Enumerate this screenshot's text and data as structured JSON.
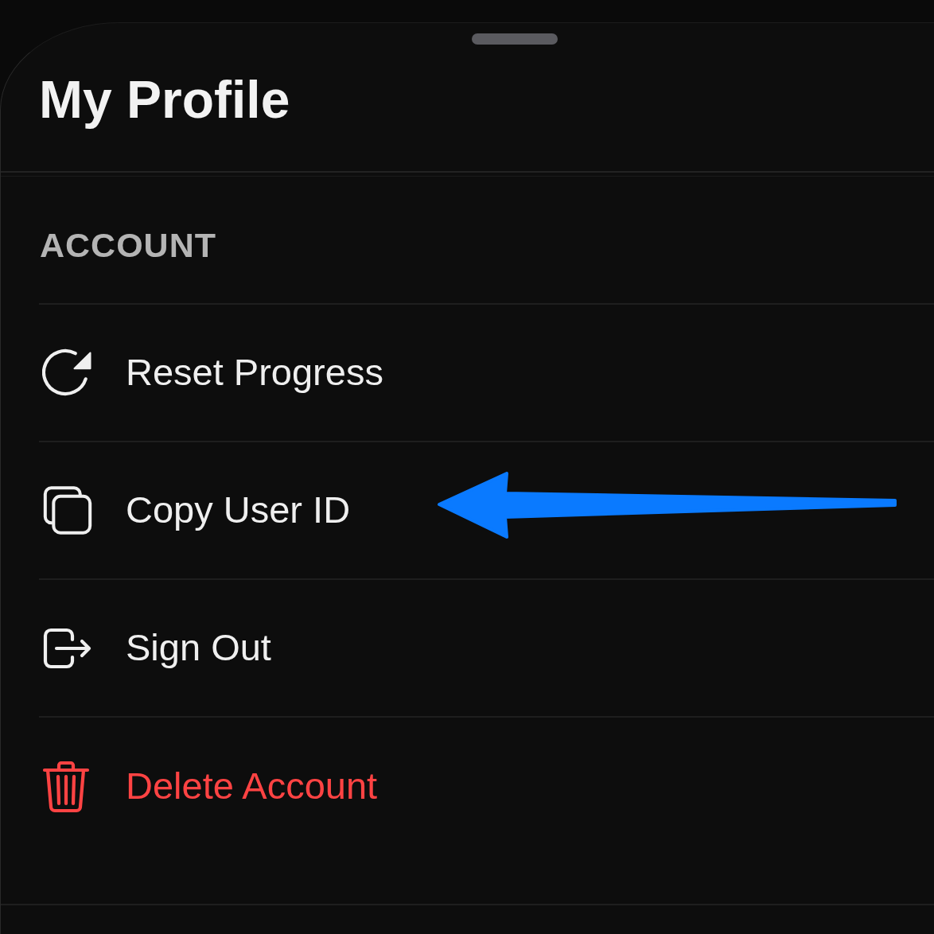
{
  "sheet": {
    "title": "My Profile"
  },
  "section": {
    "header": "ACCOUNT",
    "items": [
      {
        "label": "Reset Progress",
        "kind": "default",
        "annotated": false
      },
      {
        "label": "Copy User ID",
        "kind": "default",
        "annotated": true
      },
      {
        "label": "Sign Out",
        "kind": "default",
        "annotated": false
      },
      {
        "label": "Delete Account",
        "kind": "destructive",
        "annotated": false
      }
    ]
  }
}
